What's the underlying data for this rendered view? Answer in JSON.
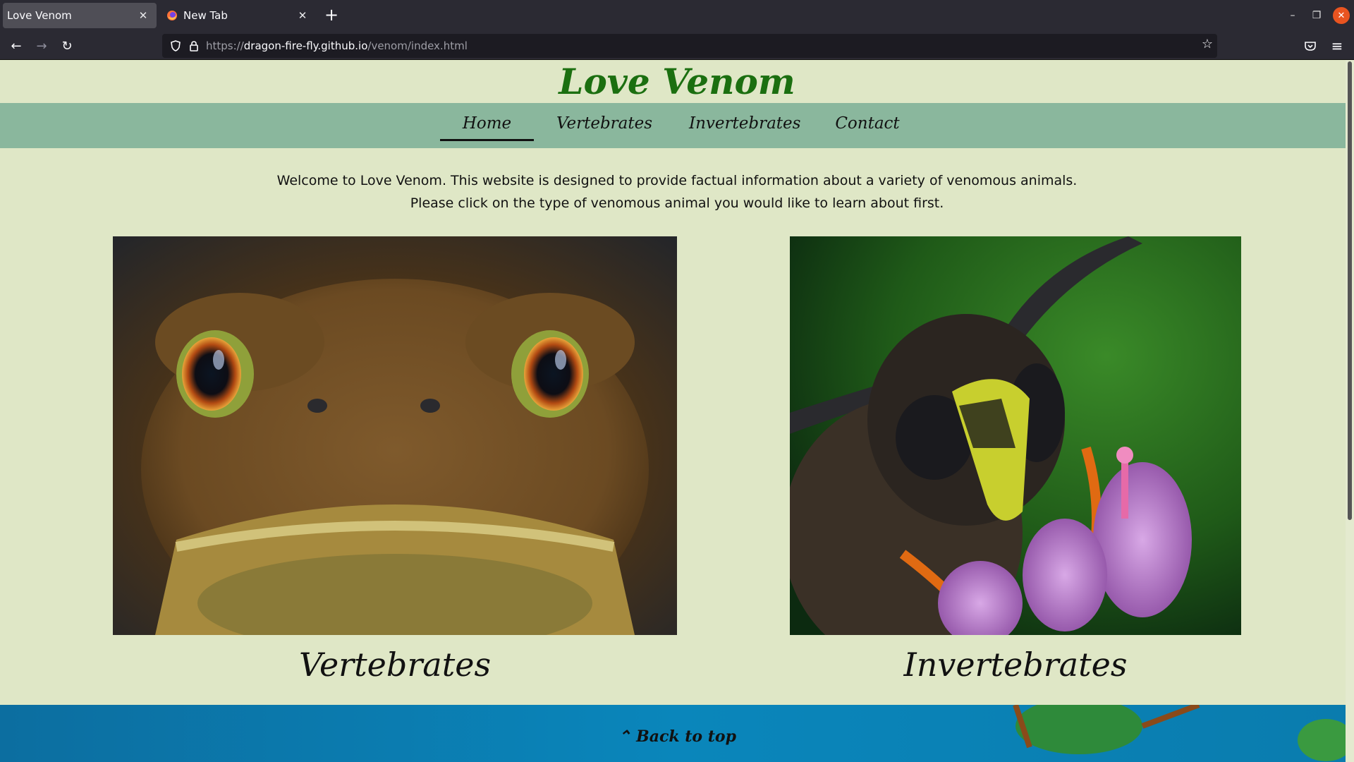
{
  "browser": {
    "tabs": [
      {
        "title": "Love Venom",
        "active": true
      },
      {
        "title": "New Tab",
        "active": false
      }
    ],
    "url": {
      "prefix": "https://",
      "host": "dragon-fire-fly.github.io",
      "path": "/venom/index.html"
    }
  },
  "site": {
    "title": "Love Venom",
    "nav": [
      "Home",
      "Vertebrates",
      "Invertebrates",
      "Contact"
    ],
    "active_nav": "Home",
    "welcome_lines": [
      "Welcome to Love Venom. This website is designed to provide factual information about a variety of venomous animals.",
      "Please click on the type of venomous animal you would like to learn about first."
    ],
    "cards": [
      {
        "label": "Vertebrates",
        "image": "toad"
      },
      {
        "label": "Invertebrates",
        "image": "wasp"
      }
    ],
    "back_to_top": "Back to top"
  },
  "colors": {
    "page_bg": "#dfe7c6",
    "nav_bg": "#8ab79d",
    "title": "#1b6f10",
    "footer": "#0a7fb1"
  }
}
